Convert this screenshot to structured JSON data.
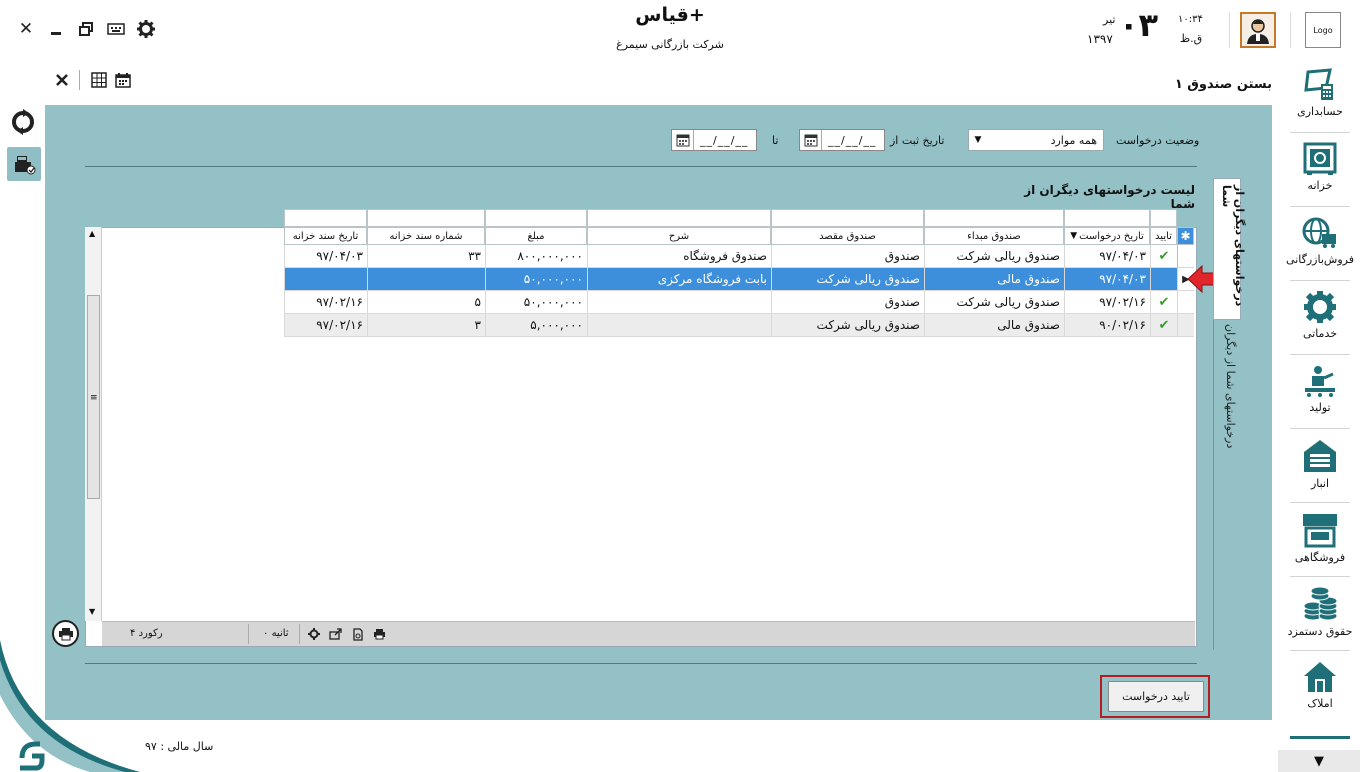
{
  "header": {
    "app_title": "قیاس+",
    "company": "شرکت بازرگانی سیمرغ",
    "day": "۰۳",
    "month": "تیر",
    "year": "۱۳۹۷",
    "time": "۱۰:۳۴",
    "ampm": "ق.ظ",
    "logo_label": "Logo"
  },
  "page": {
    "title": "بستن صندوق ۱"
  },
  "filters": {
    "status_label": "وضعیت درخواست",
    "status_value": "همه موارد",
    "date_from_label": "تاریخ ثبت از",
    "date_to_label": "تا",
    "date_mask": "__/__/__"
  },
  "list": {
    "title": "لیست درخواستهای دیگران از شما",
    "columns": [
      "تایید",
      "تاریخ درخواست",
      "صندوق مبداء",
      "صندوق مقصد",
      "شرح",
      "مبلغ",
      "شماره سند خزانه",
      "تاریخ سند خزانه"
    ],
    "rows": [
      {
        "approved": "✔",
        "date": "۹۷/۰۴/۰۳",
        "source": "صندوق ریالی شرکت",
        "dest": "صندوق",
        "desc": "صندوق فروشگاه",
        "amount": "۸۰۰,۰۰۰,۰۰۰",
        "doc_no": "۳۳",
        "doc_date": "۹۷/۰۴/۰۳"
      },
      {
        "approved": "",
        "date": "۹۷/۰۴/۰۳",
        "source": "صندوق مالی",
        "dest": "صندوق ریالی شرکت",
        "desc": "بابت فروشگاه مرکزی",
        "amount": "۵۰,۰۰۰,۰۰۰",
        "doc_no": "",
        "doc_date": ""
      },
      {
        "approved": "✔",
        "date": "۹۷/۰۲/۱۶",
        "source": "صندوق ریالی شرکت",
        "dest": "صندوق",
        "desc": "",
        "amount": "۵۰,۰۰۰,۰۰۰",
        "doc_no": "۵",
        "doc_date": "۹۷/۰۲/۱۶"
      },
      {
        "approved": "✔",
        "date": "۹۰/۰۲/۱۶",
        "source": "صندوق مالی",
        "dest": "صندوق ریالی شرکت",
        "desc": "",
        "amount": "۵,۰۰۰,۰۰۰",
        "doc_no": "۳",
        "doc_date": "۹۷/۰۲/۱۶"
      }
    ],
    "records_label": "۴ رکورد",
    "seconds_label": "۰ ثانیه"
  },
  "tabs": {
    "active": "درخواستهای دیگران از شما",
    "other": "درخواستهای شما از دیگران"
  },
  "actions": {
    "confirm": "تایید درخواست"
  },
  "nav": [
    {
      "label": "حسابداری",
      "icon": "accounting-icon"
    },
    {
      "label": "خزانه",
      "icon": "treasury-icon"
    },
    {
      "label": "فروش‌بازرگانی",
      "icon": "commerce-icon"
    },
    {
      "label": "خدماتی",
      "icon": "services-icon"
    },
    {
      "label": "تولید",
      "icon": "production-icon"
    },
    {
      "label": "انبار",
      "icon": "warehouse-icon"
    },
    {
      "label": "فروشگاهی",
      "icon": "store-icon"
    },
    {
      "label": "حقوق دستمزد",
      "icon": "payroll-icon"
    },
    {
      "label": "املاک",
      "icon": "property-icon"
    }
  ],
  "footer": {
    "fiscal_year": "سال مالی : ۹۷"
  },
  "colors": {
    "panel": "#93c1c6",
    "selected_row": "#3d8fdc",
    "accent_red": "#b71c23",
    "nav_teal": "#1f6f78"
  }
}
